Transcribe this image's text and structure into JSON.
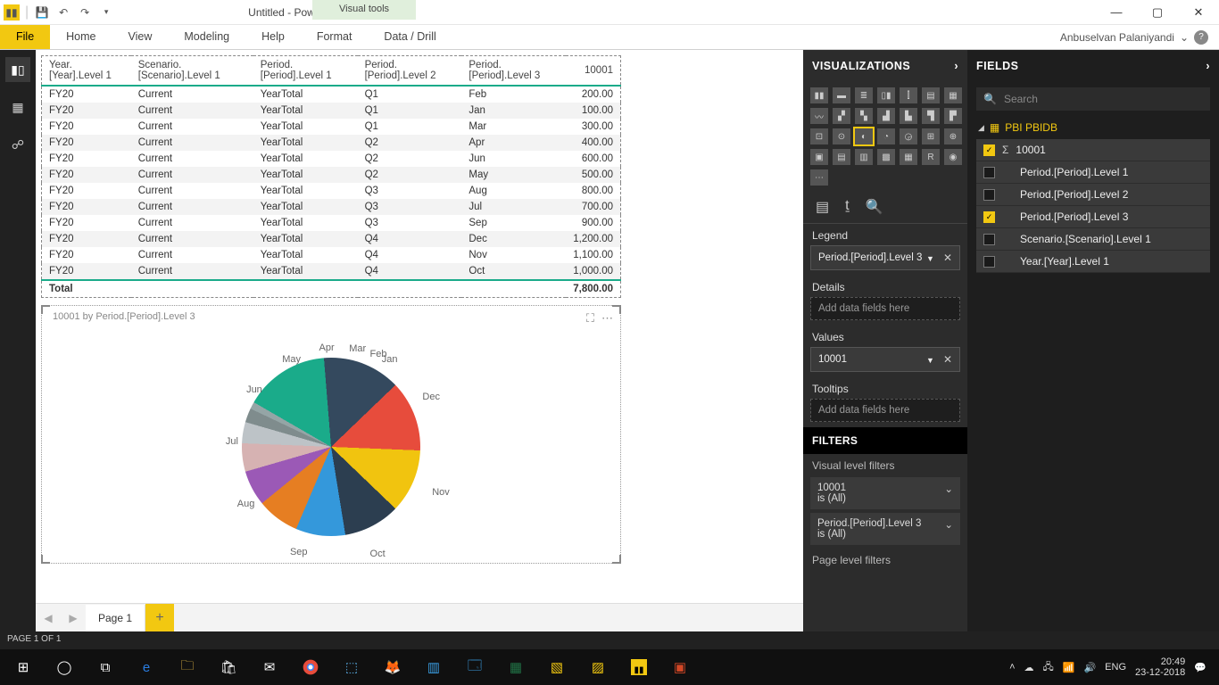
{
  "window": {
    "title": "Untitled - Power BI Desktop",
    "visual_tools": "Visual tools"
  },
  "ribbon": {
    "file": "File",
    "tabs": [
      "Home",
      "View",
      "Modeling",
      "Help",
      "Format",
      "Data / Drill"
    ]
  },
  "user": "Anbuselvan Palaniyandi",
  "left_nav": [
    "report-icon",
    "data-icon",
    "model-icon"
  ],
  "table": {
    "headers": [
      "Year.[Year].Level 1",
      "Scenario.[Scenario].Level 1",
      "Period.[Period].Level 1",
      "Period.[Period].Level 2",
      "Period.[Period].Level 3",
      "10001"
    ],
    "rows": [
      [
        "FY20",
        "Current",
        "YearTotal",
        "Q1",
        "Feb",
        "200.00"
      ],
      [
        "FY20",
        "Current",
        "YearTotal",
        "Q1",
        "Jan",
        "100.00"
      ],
      [
        "FY20",
        "Current",
        "YearTotal",
        "Q1",
        "Mar",
        "300.00"
      ],
      [
        "FY20",
        "Current",
        "YearTotal",
        "Q2",
        "Apr",
        "400.00"
      ],
      [
        "FY20",
        "Current",
        "YearTotal",
        "Q2",
        "Jun",
        "600.00"
      ],
      [
        "FY20",
        "Current",
        "YearTotal",
        "Q2",
        "May",
        "500.00"
      ],
      [
        "FY20",
        "Current",
        "YearTotal",
        "Q3",
        "Aug",
        "800.00"
      ],
      [
        "FY20",
        "Current",
        "YearTotal",
        "Q3",
        "Jul",
        "700.00"
      ],
      [
        "FY20",
        "Current",
        "YearTotal",
        "Q3",
        "Sep",
        "900.00"
      ],
      [
        "FY20",
        "Current",
        "YearTotal",
        "Q4",
        "Dec",
        "1,200.00"
      ],
      [
        "FY20",
        "Current",
        "YearTotal",
        "Q4",
        "Nov",
        "1,100.00"
      ],
      [
        "FY20",
        "Current",
        "YearTotal",
        "Q4",
        "Oct",
        "1,000.00"
      ]
    ],
    "total_label": "Total",
    "total_value": "7,800.00"
  },
  "chart_title": "10001 by Period.[Period].Level 3",
  "chart_data": {
    "type": "pie",
    "title": "10001 by Period.[Period].Level 3",
    "slices": [
      {
        "label": "Dec",
        "value": 1200,
        "color": "#1aab8a"
      },
      {
        "label": "Nov",
        "value": 1100,
        "color": "#34495e"
      },
      {
        "label": "Oct",
        "value": 1000,
        "color": "#e74c3c"
      },
      {
        "label": "Sep",
        "value": 900,
        "color": "#f1c40f"
      },
      {
        "label": "Aug",
        "value": 800,
        "color": "#2c3e50"
      },
      {
        "label": "Jul",
        "value": 700,
        "color": "#3498db"
      },
      {
        "label": "Jun",
        "value": 600,
        "color": "#e67e22"
      },
      {
        "label": "May",
        "value": 500,
        "color": "#9b59b6"
      },
      {
        "label": "Apr",
        "value": 400,
        "color": "#d6b2b2"
      },
      {
        "label": "Mar",
        "value": 300,
        "color": "#bdc3c7"
      },
      {
        "label": "Feb",
        "value": 200,
        "color": "#7f8c8d"
      },
      {
        "label": "Jan",
        "value": 100,
        "color": "#95a5a6"
      }
    ]
  },
  "page": {
    "current": "Page 1",
    "status": "PAGE 1 OF 1"
  },
  "viz": {
    "head": "VISUALIZATIONS",
    "wells": {
      "legend": {
        "label": "Legend",
        "value": "Period.[Period].Level 3"
      },
      "details": {
        "label": "Details",
        "placeholder": "Add data fields here"
      },
      "values": {
        "label": "Values",
        "value": "10001"
      },
      "tooltips": {
        "label": "Tooltips",
        "placeholder": "Add data fields here"
      }
    },
    "filters_head": "FILTERS",
    "vlf_label": "Visual level filters",
    "filters": [
      {
        "name": "10001",
        "state": "is (All)"
      },
      {
        "name": "Period.[Period].Level 3",
        "state": "is (All)"
      }
    ],
    "plf_label": "Page level filters"
  },
  "fields": {
    "head": "FIELDS",
    "search": "Search",
    "table_name": "PBI PBIDB",
    "items": [
      {
        "label": "10001",
        "checked": true,
        "sigma": true
      },
      {
        "label": "Period.[Period].Level 1",
        "checked": false
      },
      {
        "label": "Period.[Period].Level 2",
        "checked": false
      },
      {
        "label": "Period.[Period].Level 3",
        "checked": true
      },
      {
        "label": "Scenario.[Scenario].Level 1",
        "checked": false
      },
      {
        "label": "Year.[Year].Level 1",
        "checked": false
      }
    ]
  },
  "tray": {
    "lang": "ENG",
    "time": "20:49",
    "date": "23-12-2018"
  }
}
